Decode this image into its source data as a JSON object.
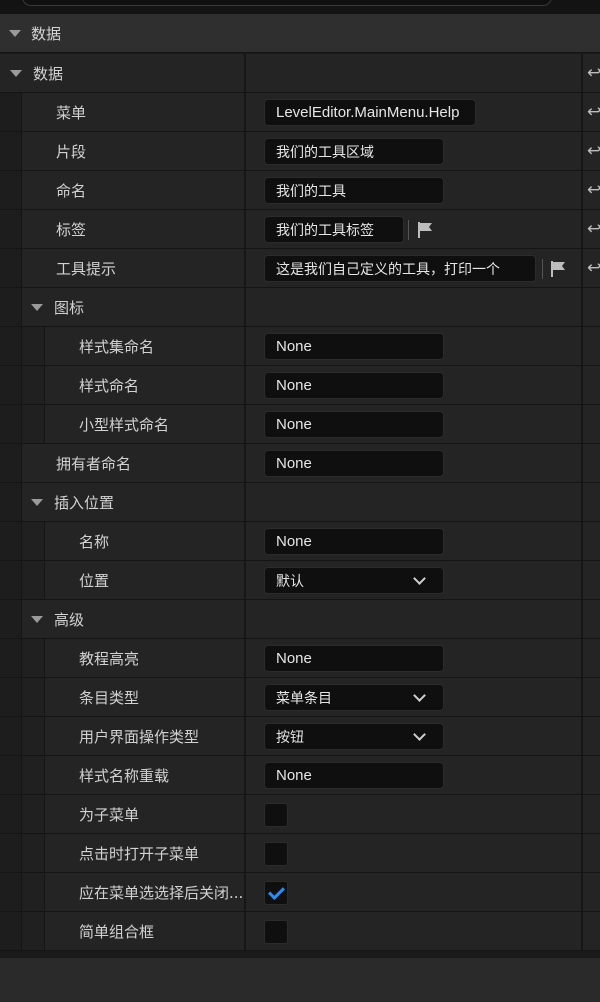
{
  "category": {
    "title": "数据"
  },
  "group": {
    "title": "数据"
  },
  "rows": {
    "menu": {
      "label": "菜单",
      "value": "LevelEditor.MainMenu.Help"
    },
    "section": {
      "label": "片段",
      "value": "我们的工具区域"
    },
    "name": {
      "label": "命名",
      "value": "我们的工具"
    },
    "tag": {
      "label": "标签",
      "value": "我们的工具标签"
    },
    "tooltip": {
      "label": "工具提示",
      "value": "这是我们自己定义的工具，打印一个"
    },
    "icon": {
      "label": "图标"
    },
    "style_set_name": {
      "label": "样式集命名",
      "value": "None"
    },
    "style_name": {
      "label": "样式命名",
      "value": "None"
    },
    "small_style_name": {
      "label": "小型样式命名",
      "value": "None"
    },
    "owner_name": {
      "label": "拥有者命名",
      "value": "None"
    },
    "insert_position": {
      "label": "插入位置"
    },
    "ins_name": {
      "label": "名称",
      "value": "None"
    },
    "ins_position": {
      "label": "位置",
      "value": "默认"
    },
    "advanced": {
      "label": "高级"
    },
    "tutorial_highlight": {
      "label": "教程高亮",
      "value": "None"
    },
    "entry_type": {
      "label": "条目类型",
      "value": "菜单条目"
    },
    "ui_action_type": {
      "label": "用户界面操作类型",
      "value": "按钮"
    },
    "style_name_override": {
      "label": "样式名称重载",
      "value": "None"
    },
    "is_submenu": {
      "label": "为子菜单",
      "checked": false
    },
    "open_submenu_on_click": {
      "label": "点击时打开子菜单",
      "checked": false
    },
    "close_after_selection": {
      "label": "应在菜单选选择后关闭...",
      "checked": true
    },
    "simple_combo_box": {
      "label": "简单组合框",
      "checked": false
    }
  },
  "reset_symbol": "↩",
  "icons": {
    "flag": "flag-icon",
    "reset": "reset-arrow-icon",
    "expand": "triangle-down-icon",
    "dropdown": "chevron-down-icon"
  },
  "colors": {
    "accent": "#2c8cf4",
    "bg": "#242424",
    "field": "#0f0f0f"
  }
}
